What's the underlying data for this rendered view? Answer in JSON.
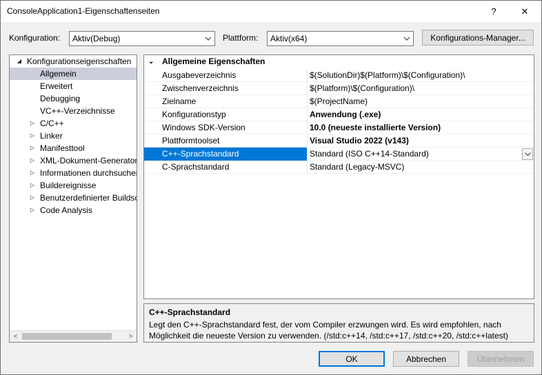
{
  "window": {
    "title": "ConsoleApplication1-Eigenschaftenseiten",
    "help_glyph": "?",
    "close_glyph": "✕"
  },
  "config": {
    "konfiguration_label": "Konfiguration:",
    "konfiguration_value": "Aktiv(Debug)",
    "plattform_label": "Plattform:",
    "plattform_value": "Aktiv(x64)",
    "manager_button": "Konfigurations-Manager..."
  },
  "tree": {
    "items": [
      {
        "label": "Konfigurationseigenschaften",
        "expander": "◢"
      },
      {
        "label": "Allgemein",
        "expander": ""
      },
      {
        "label": "Erweitert",
        "expander": ""
      },
      {
        "label": "Debugging",
        "expander": ""
      },
      {
        "label": "VC++-Verzeichnisse",
        "expander": ""
      },
      {
        "label": "C/C++",
        "expander": "▷"
      },
      {
        "label": "Linker",
        "expander": "▷"
      },
      {
        "label": "Manifesttool",
        "expander": "▷"
      },
      {
        "label": "XML-Dokument-Generator",
        "expander": "▷"
      },
      {
        "label": "Informationen durchsuchen",
        "expander": "▷"
      },
      {
        "label": "Buildereignisse",
        "expander": "▷"
      },
      {
        "label": "Benutzerdefinierter Buildschritt",
        "expander": "▷"
      },
      {
        "label": "Code Analysis",
        "expander": "▷"
      }
    ],
    "scroll_left": "<",
    "scroll_right": ">"
  },
  "grid": {
    "section_title": "Allgemeine Eigenschaften",
    "section_expander": "⌄",
    "rows": [
      {
        "name": "Ausgabeverzeichnis",
        "value": "$(SolutionDir)$(Platform)\\$(Configuration)\\"
      },
      {
        "name": "Zwischenverzeichnis",
        "value": "$(Platform)\\$(Configuration)\\"
      },
      {
        "name": "Zielname",
        "value": "$(ProjectName)"
      },
      {
        "name": "Konfigurationstyp",
        "value": "Anwendung (.exe)"
      },
      {
        "name": "Windows SDK-Version",
        "value": "10.0 (neueste installierte Version)"
      },
      {
        "name": "Plattformtoolset",
        "value": "Visual Studio 2022 (v143)"
      },
      {
        "name": "C++-Sprachstandard",
        "value": "Standard (ISO C++14-Standard)"
      },
      {
        "name": "C-Sprachstandard",
        "value": "Standard (Legacy-MSVC)"
      }
    ]
  },
  "description": {
    "title": "C++-Sprachstandard",
    "text": "Legt den C++-Sprachstandard fest, der vom Compiler erzwungen wird. Es wird empfohlen, nach Möglichkeit die neueste Version zu verwenden.  (/std:c++14, /std:c++17, /std:c++20, /std:c++latest)"
  },
  "buttons": {
    "ok": "OK",
    "cancel": "Abbrechen",
    "apply": "Übernehmen"
  }
}
